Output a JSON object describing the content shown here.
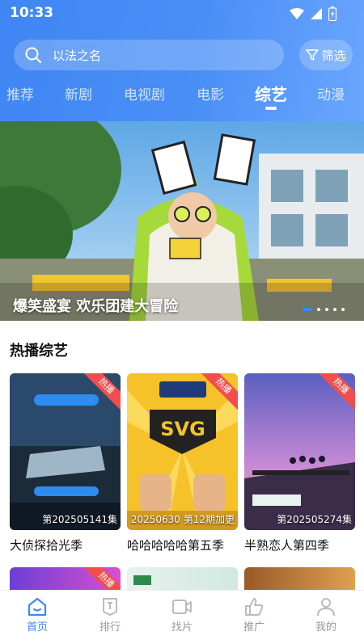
{
  "status": {
    "time": "10:33"
  },
  "search": {
    "placeholder": "以法之名",
    "filter_label": "筛选"
  },
  "tabs": [
    {
      "label": "推荐"
    },
    {
      "label": "新剧"
    },
    {
      "label": "电视剧"
    },
    {
      "label": "电影"
    },
    {
      "label": "综艺",
      "active": true
    },
    {
      "label": "动漫"
    }
  ],
  "banner": {
    "caption": "爆笑盛宴 欢乐团建大冒险",
    "slides": 5,
    "current": 1
  },
  "section": {
    "title": "热播综艺"
  },
  "cards": [
    {
      "title": "大侦探拾光季",
      "episode": "第202505141集",
      "badge": "热播"
    },
    {
      "title": "哈哈哈哈哈第五季",
      "episode": "20250630 第12期加更",
      "badge": "热播"
    },
    {
      "title": "半熟恋人第四季",
      "episode": "第202505274集",
      "badge": "热播"
    }
  ],
  "next_row_badge": "热播",
  "bottom_nav": [
    {
      "label": "首页",
      "active": true
    },
    {
      "label": "排行"
    },
    {
      "label": "找片"
    },
    {
      "label": "推广"
    },
    {
      "label": "我的"
    }
  ],
  "colors": {
    "accent": "#3f86f4",
    "badge": "#f24d4d"
  }
}
